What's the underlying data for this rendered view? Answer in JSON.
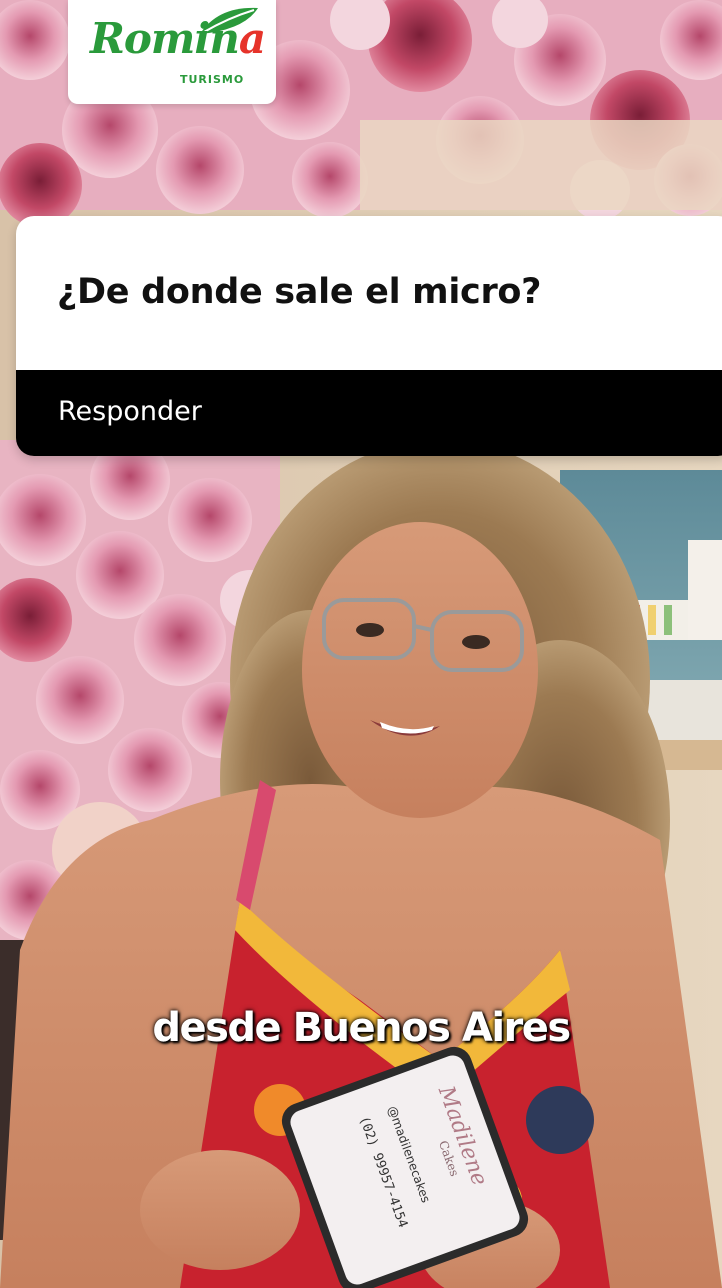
{
  "brand": {
    "name_main": "Romin",
    "name_accent": "a",
    "subtitle": "TURISMO",
    "color_green": "#2a9a3b",
    "color_red": "#e6332a"
  },
  "question_sticker": {
    "question": "¿De donde sale el micro?",
    "reply_label": "Responder"
  },
  "caption": {
    "text": "desde Buenos Aires"
  },
  "business_card": {
    "brand": "Madilene",
    "brand_sub": "Cakes",
    "handle": "@madilenecakes",
    "phone": "(02) 99957-4154"
  },
  "icons": {
    "logo": "leaf-icon"
  }
}
